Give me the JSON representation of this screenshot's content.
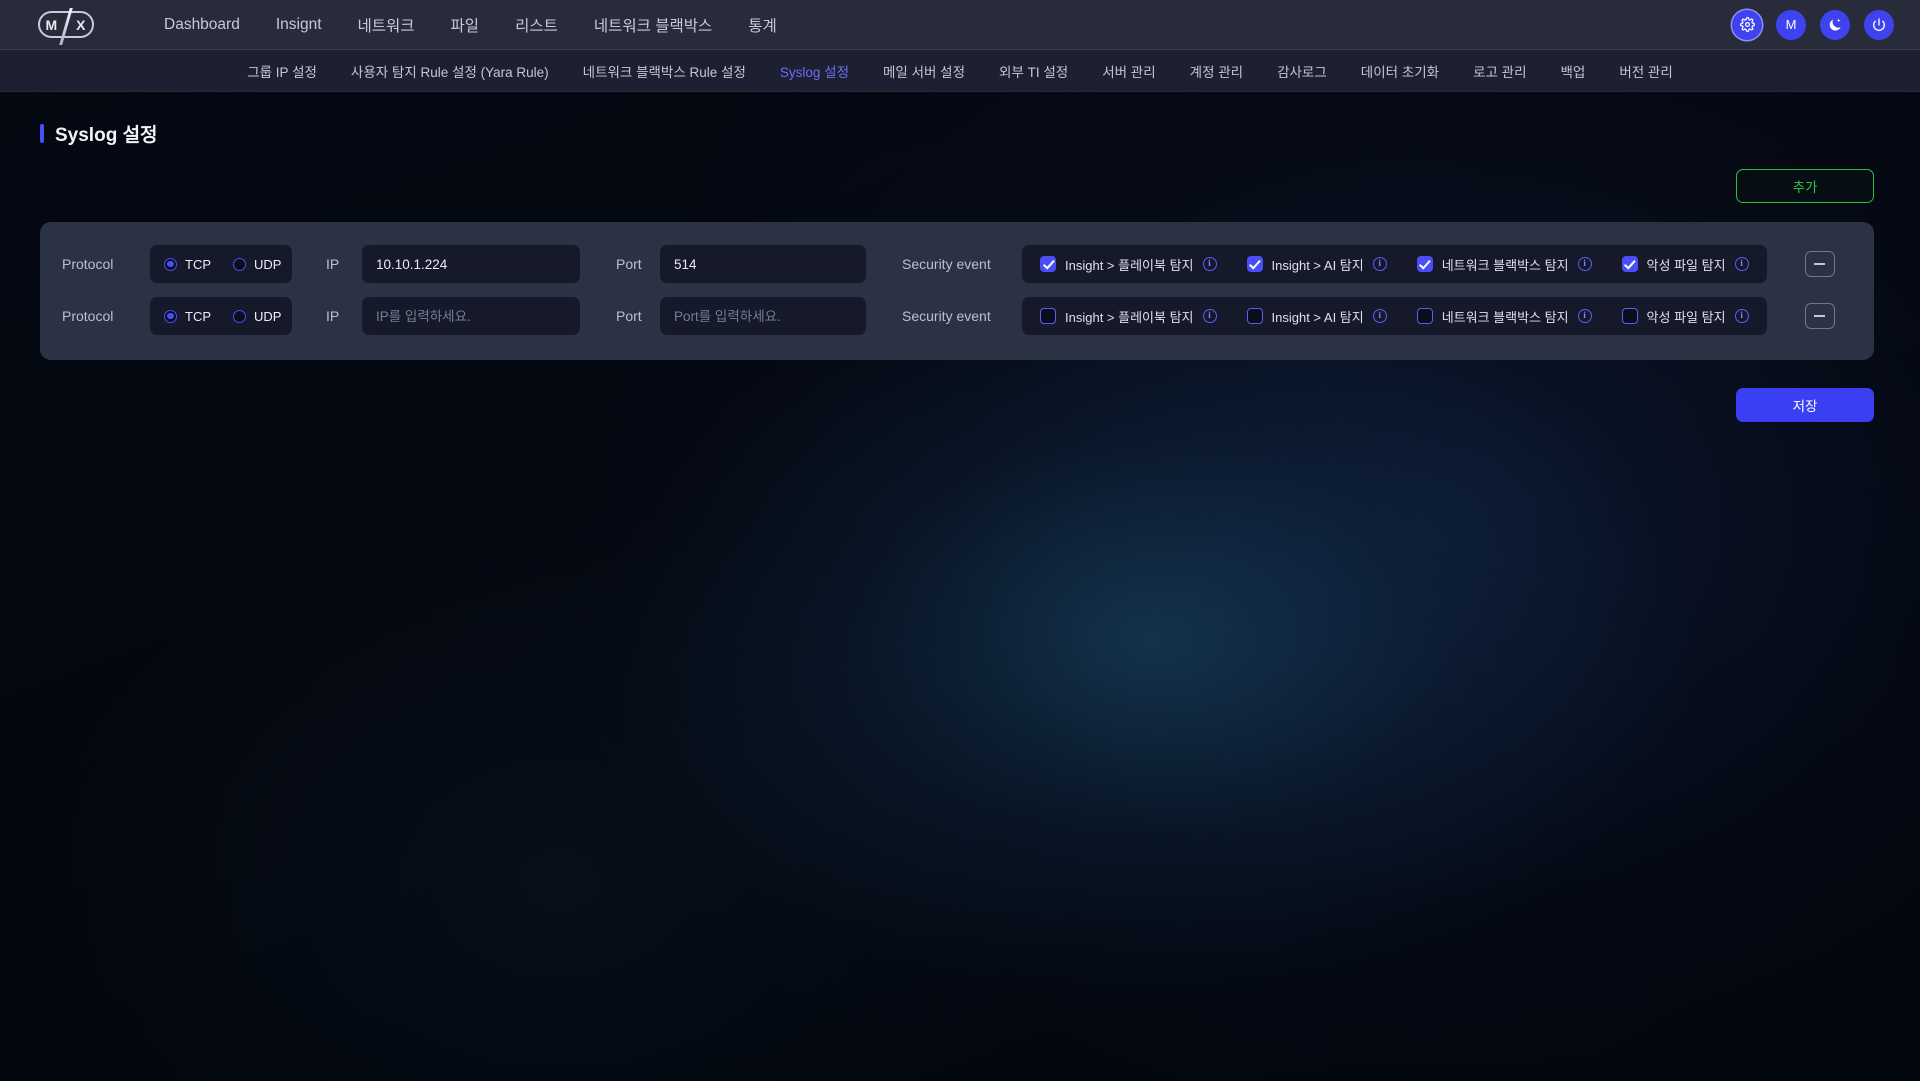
{
  "topbar": {
    "logo_m": "M",
    "logo_x": "X",
    "nav": [
      {
        "label": "Dashboard"
      },
      {
        "label": "Insignt"
      },
      {
        "label": "네트워크"
      },
      {
        "label": "파일"
      },
      {
        "label": "리스트"
      },
      {
        "label": "네트워크 블랙박스"
      },
      {
        "label": "통계"
      }
    ],
    "actions": [
      {
        "name": "settings-gear",
        "label": ""
      },
      {
        "name": "user-avatar",
        "label": "M"
      },
      {
        "name": "dark-mode-moon",
        "label": ""
      },
      {
        "name": "power-logout",
        "label": ""
      }
    ]
  },
  "subnav": {
    "items": [
      {
        "label": "그룹 IP 설정",
        "active": false
      },
      {
        "label": "사용자 탐지 Rule 설정 (Yara Rule)",
        "active": false
      },
      {
        "label": "네트워크 블랙박스 Rule 설정",
        "active": false
      },
      {
        "label": "Syslog 설정",
        "active": true
      },
      {
        "label": "메일 서버 설정",
        "active": false
      },
      {
        "label": "외부 TI 설정",
        "active": false
      },
      {
        "label": "서버 관리",
        "active": false
      },
      {
        "label": "계정 관리",
        "active": false
      },
      {
        "label": "감사로그",
        "active": false
      },
      {
        "label": "데이터 초기화",
        "active": false
      },
      {
        "label": "로고 관리",
        "active": false
      },
      {
        "label": "백업",
        "active": false
      },
      {
        "label": "버전 관리",
        "active": false
      }
    ]
  },
  "page": {
    "title": "Syslog 설정",
    "add_button": "추가",
    "save_button": "저장"
  },
  "labels": {
    "protocol": "Protocol",
    "ip": "IP",
    "port": "Port",
    "security_event": "Security event",
    "tcp": "TCP",
    "udp": "UDP",
    "info_glyph": "i"
  },
  "placeholders": {
    "ip": "IP를 입력하세요.",
    "port": "Port를 입력하세요."
  },
  "rows": [
    {
      "protocol": "TCP",
      "ip_value": "10.10.1.224",
      "port_value": "514",
      "events": [
        {
          "label": "Insight > 플레이북 탐지",
          "checked": true
        },
        {
          "label": "Insight > AI 탐지",
          "checked": true
        },
        {
          "label": "네트워크 블랙박스 탐지",
          "checked": true
        },
        {
          "label": "악성 파일 탐지",
          "checked": true
        }
      ]
    },
    {
      "protocol": "TCP",
      "ip_value": "",
      "port_value": "",
      "events": [
        {
          "label": "Insight > 플레이북 탐지",
          "checked": false
        },
        {
          "label": "Insight > AI 탐지",
          "checked": false
        },
        {
          "label": "네트워크 블랙박스 탐지",
          "checked": false
        },
        {
          "label": "악성 파일 탐지",
          "checked": false
        }
      ]
    }
  ],
  "colors": {
    "accent_blue": "#4b4ef6",
    "accent_green": "#2ec94c",
    "panel": "#2b3243",
    "input_bg": "#151929",
    "topbar_bg": "#272b3a",
    "subnav_bg": "#1c2030"
  }
}
